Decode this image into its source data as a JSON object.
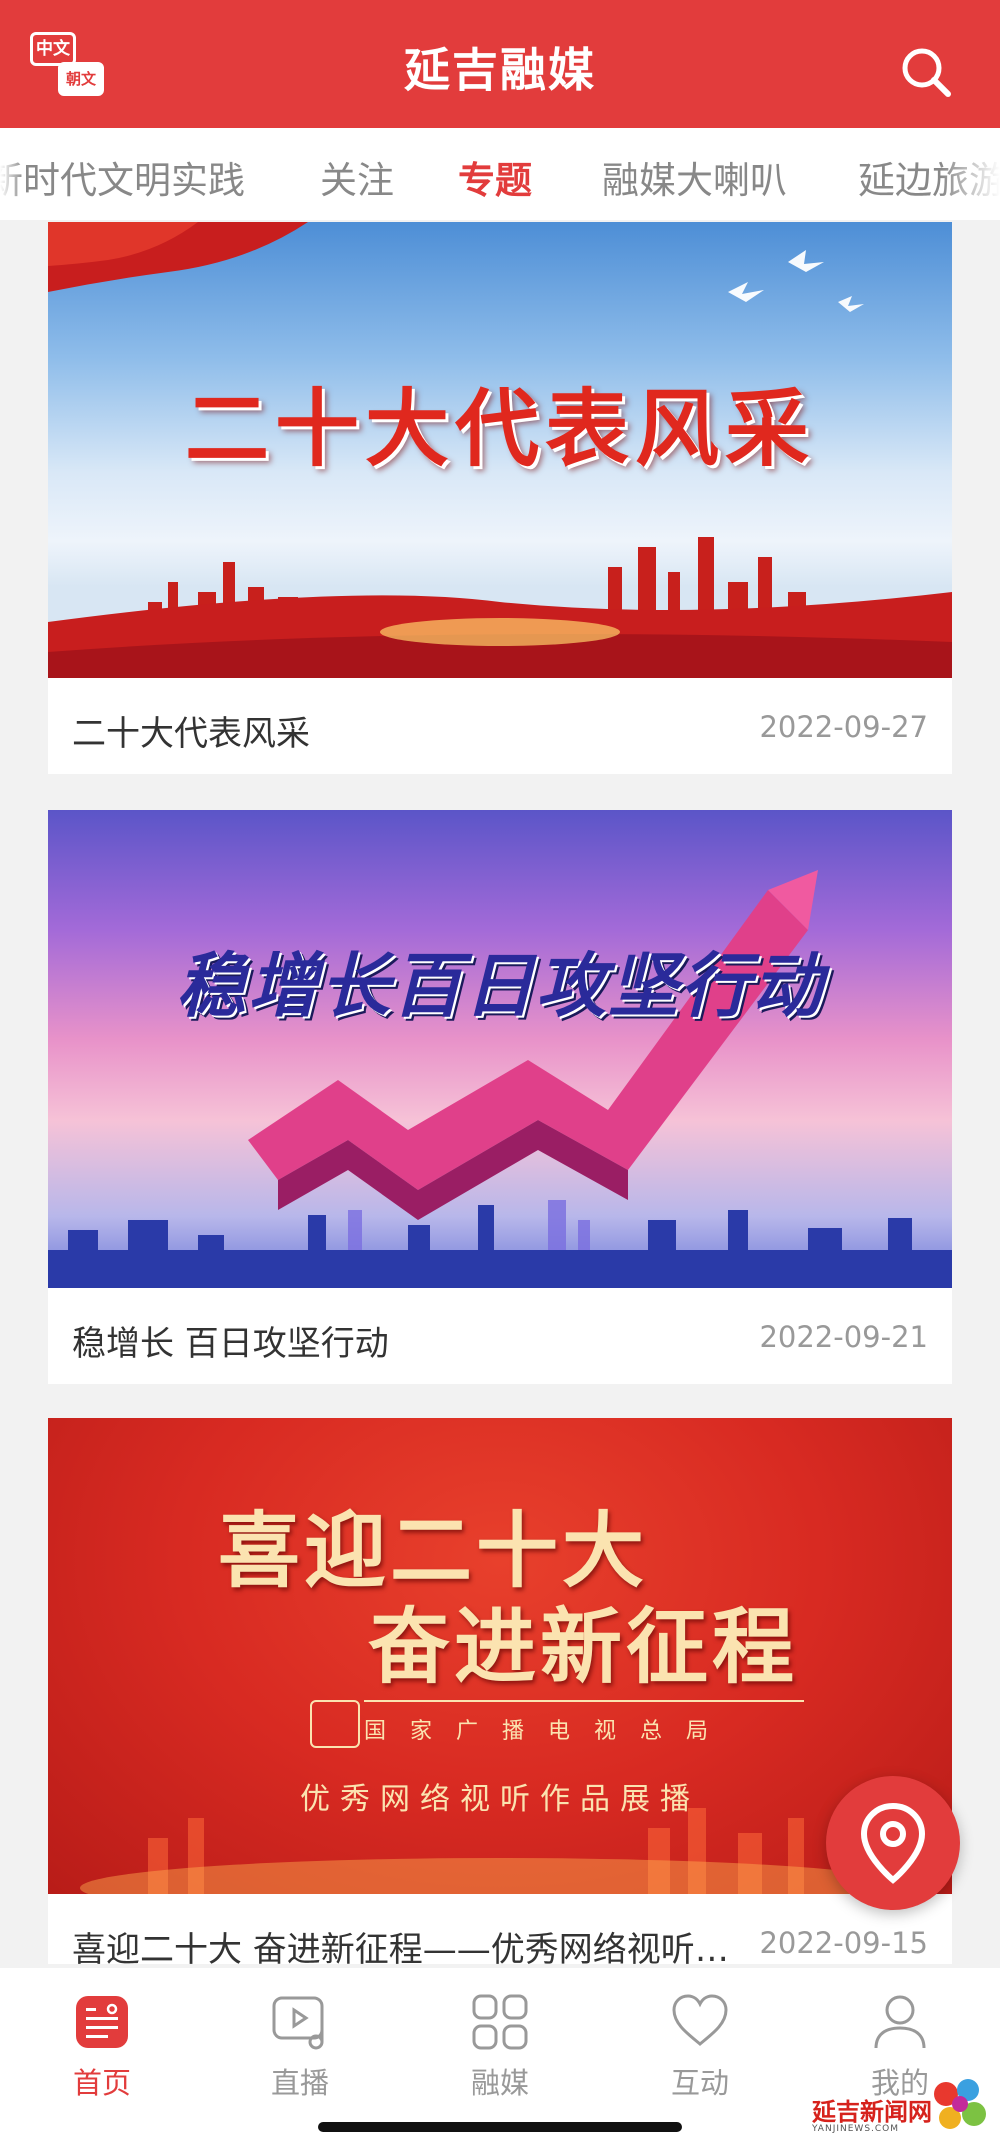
{
  "header": {
    "title": "延吉融媒",
    "lang_top": "中文",
    "lang_bottom": "朝文"
  },
  "tabs": [
    {
      "label": "新时代文明实践"
    },
    {
      "label": "关注"
    },
    {
      "label": "专题"
    },
    {
      "label": "融媒大喇叭"
    },
    {
      "label": "延边旅游"
    }
  ],
  "cards": [
    {
      "title": "二十大代表风采",
      "date": "2022-09-27",
      "banner": "二十大代表风采"
    },
    {
      "title": "稳增长 百日攻坚行动",
      "date": "2022-09-21",
      "banner": "稳增长百日攻坚行动"
    },
    {
      "title": "喜迎二十大 奋进新征程——优秀网络视听作品展播",
      "date": "2022-09-15",
      "banner_line1": "喜迎二十大",
      "banner_line2": "奋进新征程",
      "banner_org": "国家广播电视总局",
      "banner_sub": "优秀网络视听作品展播"
    }
  ],
  "nav": [
    {
      "label": "首页",
      "icon": "home-icon"
    },
    {
      "label": "直播",
      "icon": "live-icon"
    },
    {
      "label": "融媒",
      "icon": "grid-icon"
    },
    {
      "label": "互动",
      "icon": "heart-icon"
    },
    {
      "label": "我的",
      "icon": "user-icon"
    }
  ],
  "watermark": {
    "text": "延吉新闻网",
    "sub": "YANJINEWS.COM"
  },
  "colors": {
    "brand": "#e23c3c",
    "inactive": "#999999",
    "tab_inactive": "#888888"
  }
}
